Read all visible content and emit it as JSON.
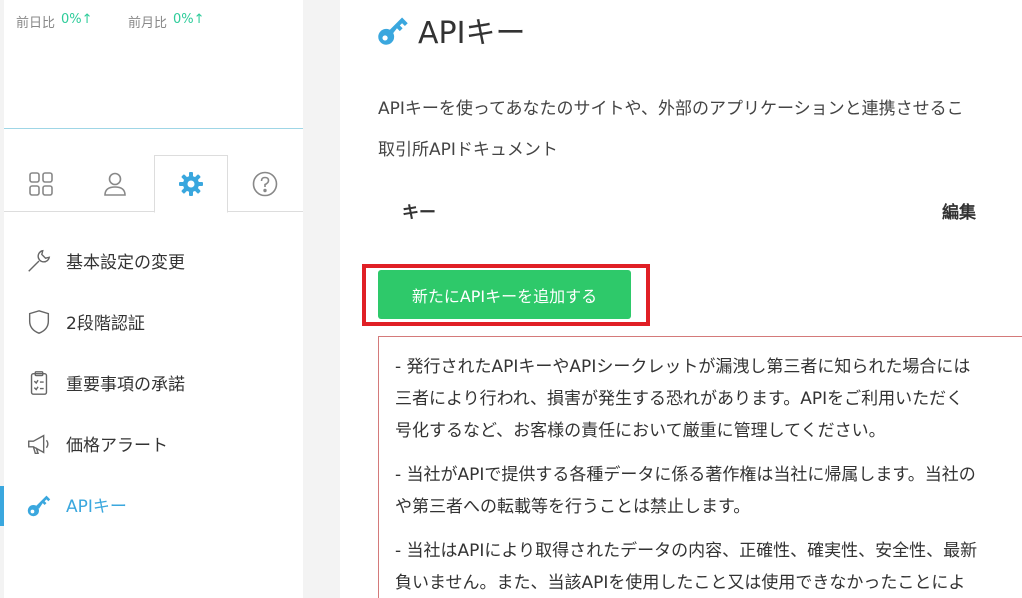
{
  "stats": {
    "day_label": "前日比",
    "day_value": "0%↑",
    "month_label": "前月比",
    "month_value": "0%↑"
  },
  "tabs": [
    {
      "name": "dashboard",
      "icon": "grid-icon"
    },
    {
      "name": "profile",
      "icon": "user-icon"
    },
    {
      "name": "settings",
      "icon": "gear-icon",
      "active": true
    },
    {
      "name": "help",
      "icon": "question-icon"
    }
  ],
  "menu": {
    "items": [
      {
        "label": "基本設定の変更",
        "icon": "wrench-icon"
      },
      {
        "label": "2段階認証",
        "icon": "shield-icon"
      },
      {
        "label": "重要事項の承諾",
        "icon": "clipboard-icon"
      },
      {
        "label": "価格アラート",
        "icon": "megaphone-icon"
      },
      {
        "label": "APIキー",
        "icon": "key-icon",
        "active": true
      }
    ]
  },
  "main": {
    "title": "APIキー",
    "description": "APIキーを使ってあなたのサイトや、外部のアプリケーションと連携させるこ",
    "doc_link": "取引所APIドキュメント",
    "table": {
      "col_key": "キー",
      "col_edit": "編集"
    },
    "add_button": "新たにAPIキーを追加する",
    "notice": {
      "p1_l1": "- 発行されたAPIキーやAPIシークレットが漏洩し第三者に知られた場合には",
      "p1_l2": "三者により行われ、損害が発生する恐れがあります。APIをご利用いただく",
      "p1_l3": "号化するなど、お客様の責任において厳重に管理してください。",
      "p2_l1": "- 当社がAPIで提供する各種データに係る著作権は当社に帰属します。当社の",
      "p2_l2": "や第三者への転載等を行うことは禁止します。",
      "p3_l1": "- 当社はAPIにより取得されたデータの内容、正確性、確実性、安全性、最新",
      "p3_l2": "負いません。また、当該APIを使用したこと又は使用できなかったことによ"
    }
  },
  "colors": {
    "accent": "#3aa7de",
    "button": "#2ec96a",
    "highlight": "#e01f25",
    "stat_up": "#2ecc9a"
  }
}
